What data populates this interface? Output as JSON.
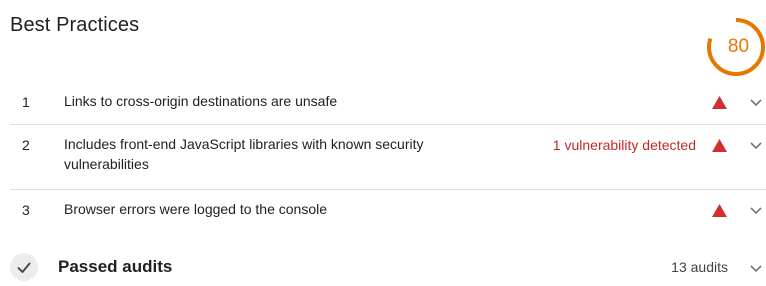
{
  "section": {
    "title": "Best Practices",
    "score": "80",
    "score_fraction": 0.8,
    "score_color": "#e67700"
  },
  "audits": [
    {
      "index": "1",
      "text": "Links to cross-origin destinations are unsafe",
      "detail": "",
      "status_icon": "warning-triangle-icon"
    },
    {
      "index": "2",
      "text": "Includes front-end JavaScript libraries with known security vulnerabilities",
      "detail": "1 vulnerability detected",
      "status_icon": "warning-triangle-icon"
    },
    {
      "index": "3",
      "text": "Browser errors were logged to the console",
      "detail": "",
      "status_icon": "warning-triangle-icon"
    }
  ],
  "passed": {
    "label": "Passed audits",
    "count": "13 audits"
  },
  "colors": {
    "warning": "#d32f2f",
    "detail_text": "#c62828",
    "divider": "#e0e0e0"
  }
}
